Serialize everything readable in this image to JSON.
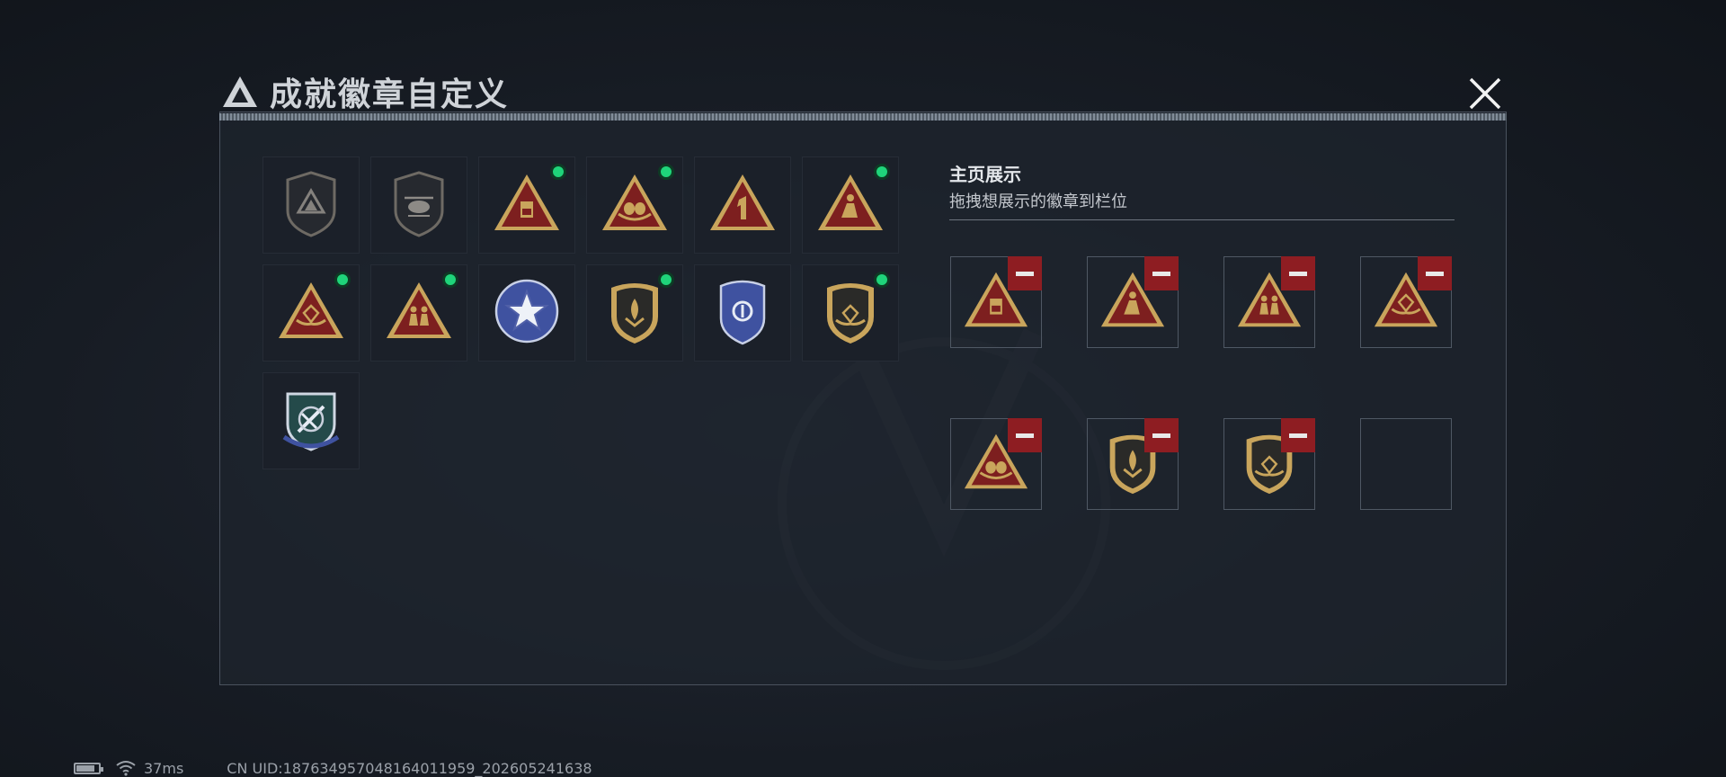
{
  "title": "成就徽章自定义",
  "close_icon": "close-icon",
  "badges": [
    {
      "icon": "delta-shield-badge",
      "shape": "shield",
      "motif": "delta",
      "unlocked": false,
      "new": false
    },
    {
      "icon": "helicopter-shield-badge",
      "shape": "shield",
      "motif": "heli",
      "unlocked": false,
      "new": false
    },
    {
      "icon": "tower-58-triangle-badge",
      "shape": "triangle",
      "motif": "tower58",
      "unlocked": true,
      "new": true
    },
    {
      "icon": "eggs-nest-triangle-badge",
      "shape": "triangle",
      "motif": "eggs",
      "unlocked": true,
      "new": true
    },
    {
      "icon": "number-one-triangle-badge",
      "shape": "triangle",
      "motif": "one",
      "unlocked": true,
      "new": false
    },
    {
      "icon": "mermaid-triangle-badge",
      "shape": "triangle",
      "motif": "figure",
      "unlocked": true,
      "new": true
    },
    {
      "icon": "gem-hands-triangle-badge",
      "shape": "triangle",
      "motif": "gem",
      "unlocked": true,
      "new": true
    },
    {
      "icon": "soldiers-triangle-badge",
      "shape": "triangle",
      "motif": "soldiers",
      "unlocked": true,
      "new": true
    },
    {
      "icon": "blue-star-badge",
      "shape": "bluestar",
      "motif": "star",
      "unlocked": true,
      "new": false
    },
    {
      "icon": "flame-shield-badge",
      "shape": "goldshield",
      "motif": "flame",
      "unlocked": true,
      "new": true
    },
    {
      "icon": "blue-wing-shield-badge",
      "shape": "blueshield",
      "motif": "wings",
      "unlocked": true,
      "new": false
    },
    {
      "icon": "gem-shield-badge",
      "shape": "goldshield",
      "motif": "gem",
      "unlocked": true,
      "new": true
    },
    {
      "icon": "blue-sword-crest-badge",
      "shape": "greenshield",
      "motif": "sword",
      "unlocked": true,
      "new": false
    }
  ],
  "showcase": {
    "title": "主页展示",
    "subtitle": "拖拽想展示的徽章到栏位",
    "slots": [
      {
        "badge": 2,
        "remove_icon": "remove-icon"
      },
      {
        "badge": 5,
        "remove_icon": "remove-icon"
      },
      {
        "badge": 7,
        "remove_icon": "remove-icon"
      },
      {
        "badge": 6,
        "remove_icon": "remove-icon"
      },
      {
        "badge": 3,
        "remove_icon": "remove-icon"
      },
      {
        "badge": 9,
        "remove_icon": "remove-icon"
      },
      {
        "badge": 11,
        "remove_icon": "remove-icon"
      },
      {
        "badge": null,
        "remove_icon": null
      }
    ]
  },
  "status_bar": {
    "battery_icon": "battery-icon",
    "wifi_icon": "wifi-icon",
    "ping": "37ms",
    "uid": "CN UID:187634957048164011959_202605241638"
  },
  "colors": {
    "new_dot": "#1fd47a",
    "remove_bg": "#8e1d22",
    "gold": "#c9a55c",
    "badge_red": "#7d1f1f",
    "blue": "#3f52a0"
  }
}
